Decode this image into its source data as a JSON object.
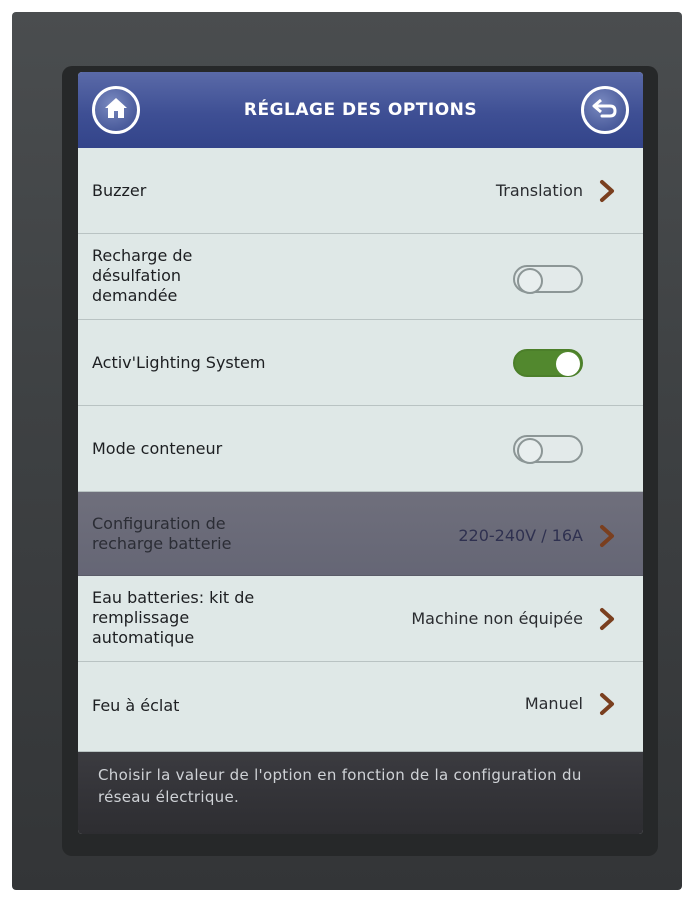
{
  "header": {
    "title": "RÉGLAGE DES OPTIONS",
    "home_icon": "home-icon",
    "back_icon": "back-arrow-icon"
  },
  "options": [
    {
      "label": "Buzzer",
      "value": "Translation",
      "type": "select"
    },
    {
      "label_lines": [
        "Recharge de",
        "désulfation",
        "demandée"
      ],
      "type": "toggle",
      "state": "off"
    },
    {
      "label": "Activ'Lighting System",
      "type": "toggle",
      "state": "on"
    },
    {
      "label": "Mode conteneur",
      "type": "toggle",
      "state": "off"
    },
    {
      "label_lines": [
        "Configuration de",
        "recharge batterie"
      ],
      "value": "220-240V / 16A",
      "type": "select",
      "selected": true
    },
    {
      "label_lines": [
        "Eau batteries: kit de",
        "remplissage",
        "automatique"
      ],
      "value": "Machine non équipée",
      "type": "select"
    },
    {
      "label": "Feu à éclat",
      "value": "Manuel",
      "type": "select"
    }
  ],
  "footer": {
    "help_text": "Choisir la valeur de l'option en fonction de la configuration du réseau électrique."
  },
  "colors": {
    "header_bg": "#3e4f94",
    "toggle_on": "#52882e",
    "chevron": "#7a3f1f",
    "selected_row": "#6a6b78"
  }
}
